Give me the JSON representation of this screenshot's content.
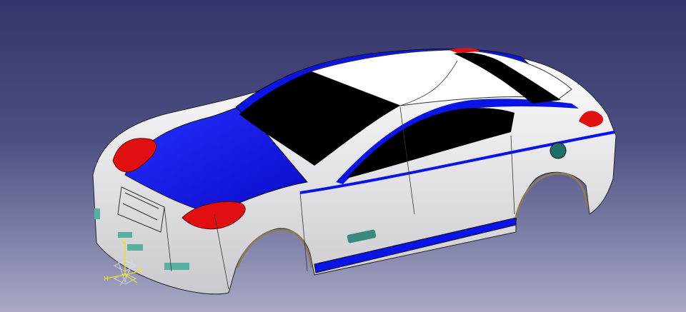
{
  "viewport": {
    "model": "car-body-surface",
    "colors": {
      "body": "#f2f2f2",
      "hood_roof_trim": "#0a14e6",
      "glass": "#000000",
      "lights": "#e01010",
      "accent_teal": "#1e6e6a",
      "axis": "#e8e800"
    }
  },
  "compass": {
    "labels": [
      "V",
      "H",
      "H"
    ]
  }
}
